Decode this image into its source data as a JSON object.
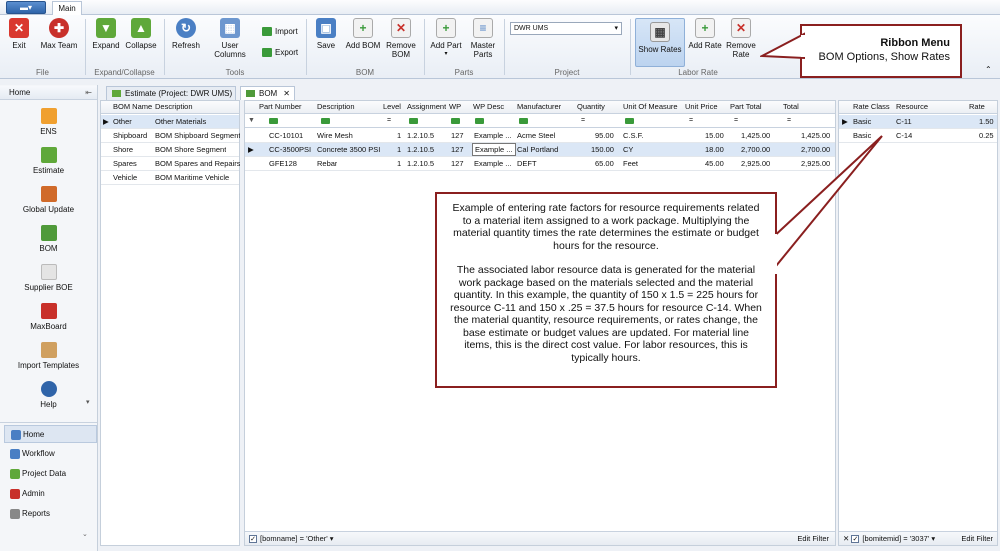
{
  "titlebar": {
    "app_menu": "▬▾",
    "tab": "Main"
  },
  "ribbon": {
    "groups": [
      "File",
      "Expand/Collapse",
      "Tools",
      "BOM",
      "Parts",
      "Project",
      "Labor Rate"
    ],
    "buttons": {
      "exit": "Exit",
      "max_team": "Max Team",
      "expand": "Expand",
      "collapse": "Collapse",
      "refresh": "Refresh",
      "user_columns": "User Columns",
      "import": "Import",
      "export": "Export",
      "save": "Save",
      "add_bom": "Add BOM",
      "remove_bom": "Remove BOM",
      "add_part": "Add Part",
      "master_parts": "Master Parts",
      "show_rates": "Show Rates",
      "add_rate": "Add Rate",
      "remove_rate": "Remove Rate"
    },
    "project_combo": "DWR UMS",
    "colors": {
      "exit": "#d9382f",
      "green": "#5fa83a",
      "blue": "#4a7fc4",
      "red": "#c8302a"
    }
  },
  "callout_ribbon": {
    "title": "Ribbon Menu",
    "text": "BOM Options, Show Rates"
  },
  "sidebar": {
    "header": "Home",
    "big_items": [
      "ENS",
      "Estimate",
      "Global Update",
      "BOM",
      "Supplier BOE",
      "MaxBoard",
      "Import Templates",
      "Help"
    ],
    "small_items": [
      "Home",
      "Workflow",
      "Project Data",
      "Admin",
      "Reports"
    ]
  },
  "doc_tabs": [
    "Estimate (Project: DWR UMS)",
    "BOM"
  ],
  "bom_list": {
    "headers": [
      "BOM Name",
      "Description"
    ],
    "rows": [
      [
        "Other",
        "Other Materials"
      ],
      [
        "Shipboard",
        "BOM Shipboard Segment"
      ],
      [
        "Shore",
        "BOM Shore Segment"
      ],
      [
        "Spares",
        "BOM Spares and Repairs"
      ],
      [
        "Vehicle",
        "BOM Maritime Vehicle"
      ]
    ]
  },
  "parts": {
    "headers": [
      "Part Number",
      "Description",
      "Level",
      "Assignment",
      "WP",
      "WP Desc",
      "Manufacturer",
      "Quantity",
      "Unit Of Measure",
      "Unit Price",
      "Part Total",
      "Total"
    ],
    "rows": [
      [
        "CC-10101",
        "Wire Mesh",
        "1",
        "1.2.10.5",
        "127",
        "Example ...",
        "Acme Steel",
        "95.00",
        "C.S.F.",
        "15.00",
        "1,425.00",
        "1,425.00"
      ],
      [
        "CC-3500PSI",
        "Concrete 3500 PSI",
        "1",
        "1.2.10.5",
        "127",
        "Example ...",
        "Cal Portland",
        "150.00",
        "CY",
        "18.00",
        "2,700.00",
        "2,700.00"
      ],
      [
        "GFE128",
        "Rebar",
        "1",
        "1.2.10.5",
        "127",
        "Example ...",
        "DEFT",
        "65.00",
        "Feet",
        "45.00",
        "2,925.00",
        "2,925.00"
      ]
    ],
    "filter_status": "[bomname] = 'Other'",
    "edit_filter": "Edit Filter"
  },
  "rates": {
    "headers": [
      "Rate Class",
      "Resource",
      "Rate"
    ],
    "rows": [
      [
        "Basic",
        "C-11",
        "1.50"
      ],
      [
        "Basic",
        "C-14",
        "0.25"
      ]
    ],
    "filter_status": "[bomitemid] = '3037'",
    "edit_filter": "Edit Filter"
  },
  "callout_main": {
    "p1": "Example of entering rate factors for resource requirements related to a material item assigned to a work package. Multiplying the material quantity times the rate determines the estimate or budget hours for the resource.",
    "p2": "The associated labor resource data is generated for the material work package based on the materials selected and the material quantity. In this example, the quantity of 150 x 1.5 = 225 hours for resource C-11 and 150 x .25 = 37.5 hours for resource C-14. When the material quantity, resource requirements, or rates change, the base estimate or budget values are updated. For material line items, this is the direct cost value. For labor resources, this is typically hours."
  }
}
